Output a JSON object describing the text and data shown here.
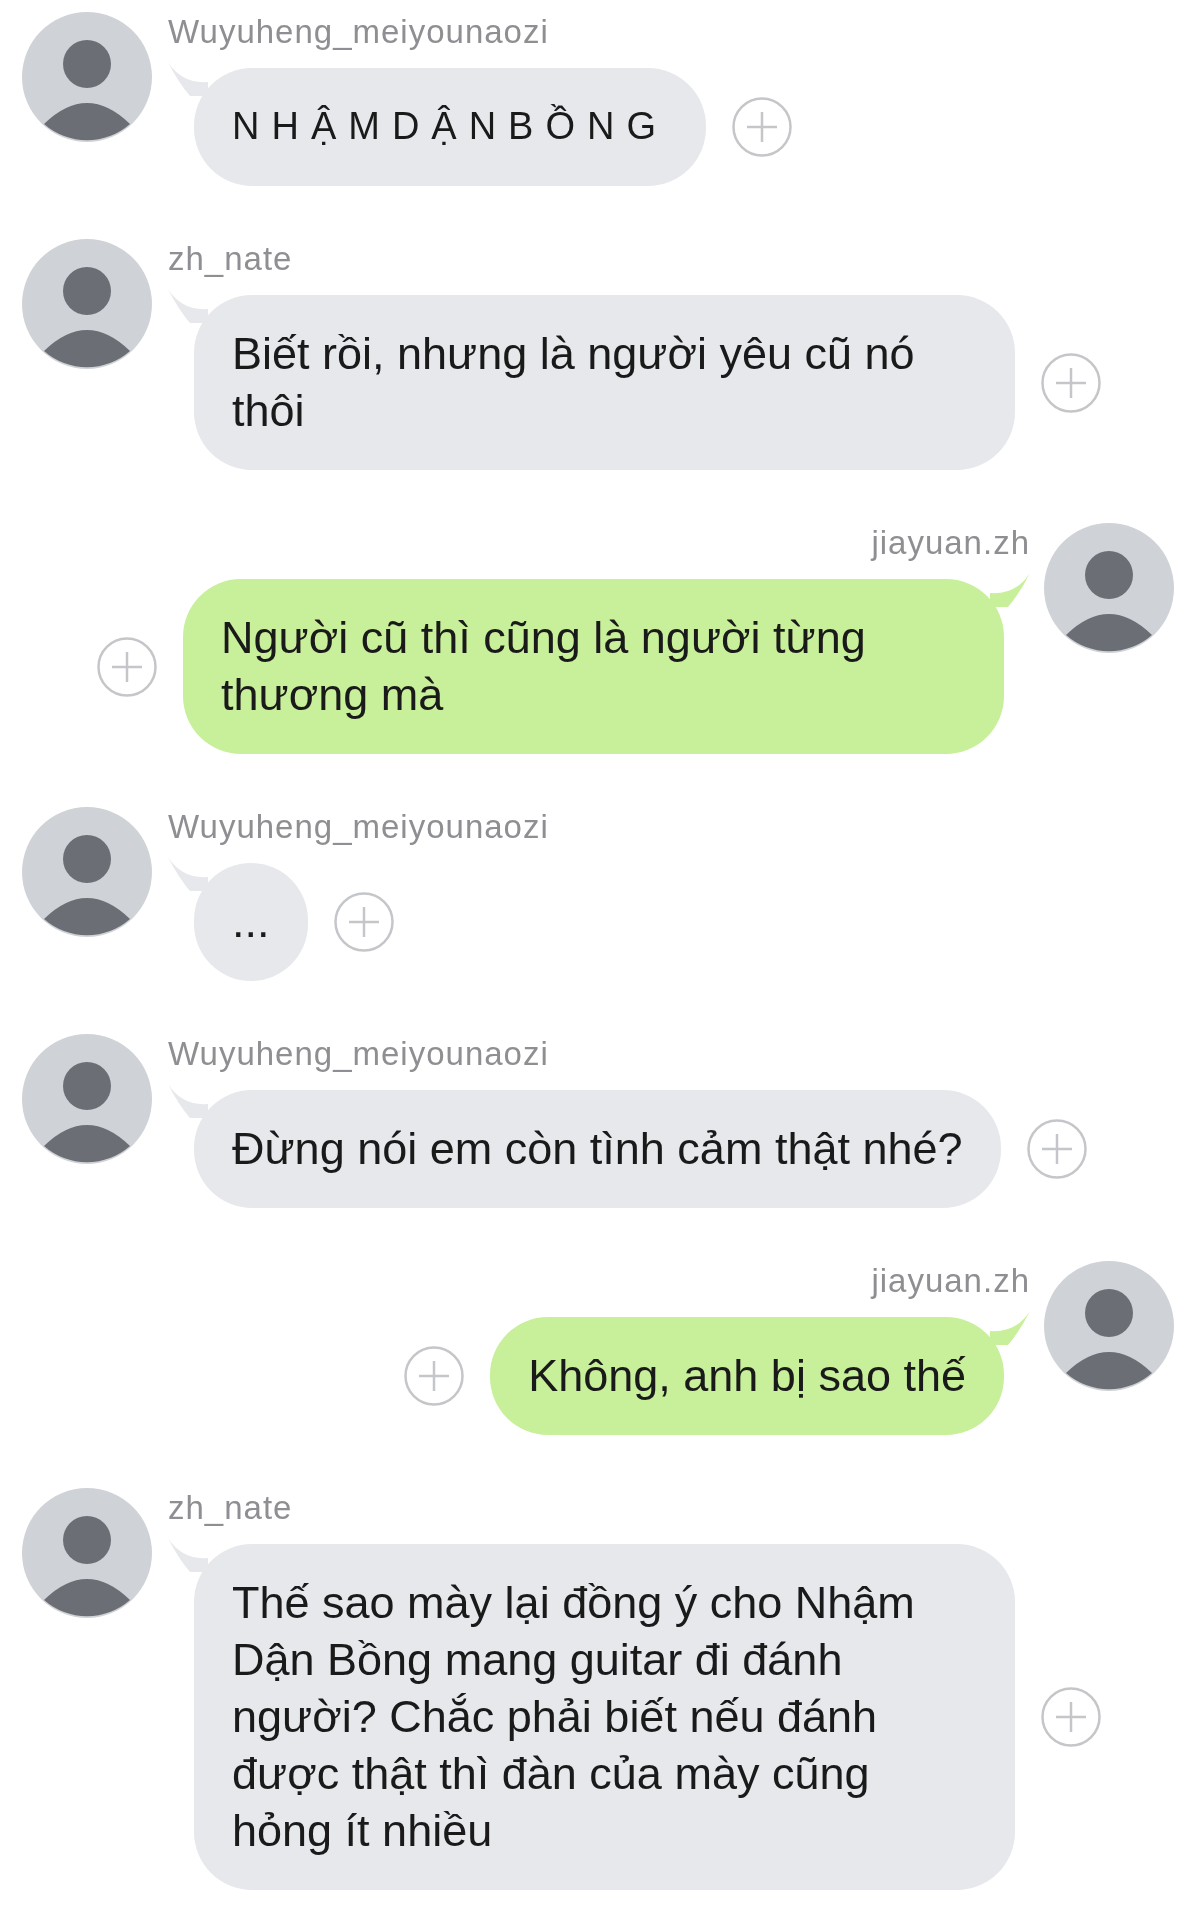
{
  "messages": [
    {
      "kind": "incoming",
      "name": "Wuyuheng_meiyounaozi",
      "text": "NHẬMDẬNBỒNG",
      "letter_spaced": true
    },
    {
      "kind": "incoming",
      "name": "zh_nate",
      "text": "Biết rồi, nhưng là người yêu cũ nó thôi",
      "letter_spaced": false
    },
    {
      "kind": "outgoing",
      "name": "jiayuan.zh",
      "text": "Người cũ thì cũng là người từng thương mà",
      "letter_spaced": false
    },
    {
      "kind": "incoming",
      "name": "Wuyuheng_meiyounaozi",
      "text": "...",
      "letter_spaced": false
    },
    {
      "kind": "incoming",
      "name": "Wuyuheng_meiyounaozi",
      "text": "Đừng nói em còn tình cảm thật nhé?",
      "letter_spaced": false
    },
    {
      "kind": "outgoing",
      "name": "jiayuan.zh",
      "text": "Không, anh bị sao thế",
      "letter_spaced": false
    },
    {
      "kind": "incoming",
      "name": "zh_nate",
      "text": "Thế sao mày lại đồng ý cho Nhậm Dận Bồng mang guitar đi đánh người? Chắc phải biết nếu đánh được thật thì đàn của mày cũng hỏng ít nhiều",
      "letter_spaced": false
    }
  ]
}
